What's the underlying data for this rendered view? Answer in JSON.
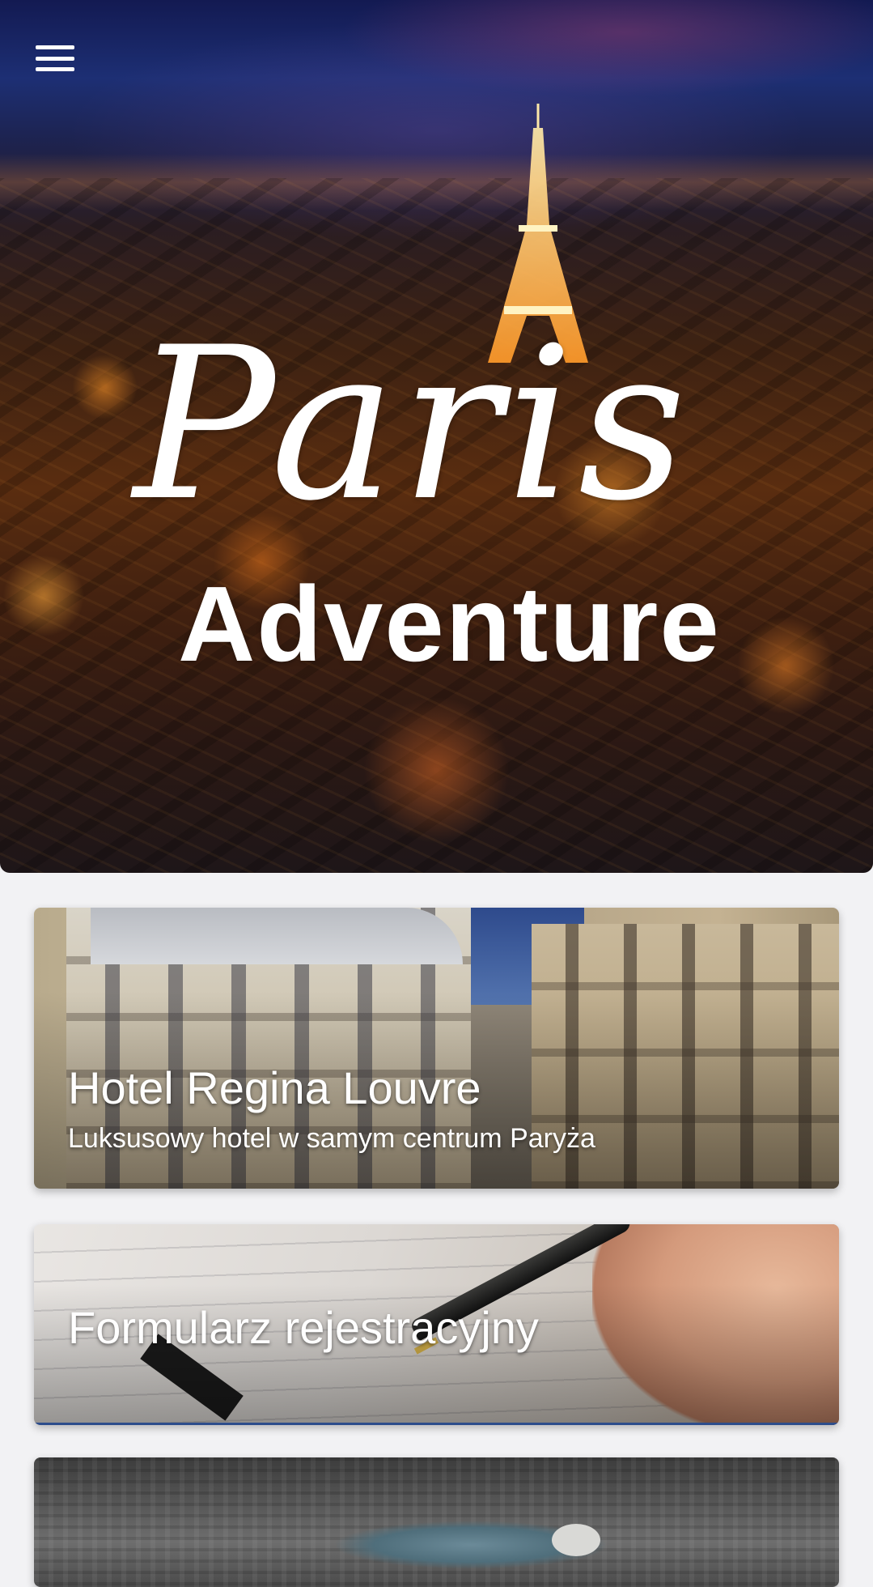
{
  "app": {
    "logo_line1": "Paris",
    "logo_line2": "Adventure"
  },
  "header": {
    "menu_icon": "hamburger-menu-icon"
  },
  "cards": [
    {
      "title": "Hotel Regina Louvre",
      "subtitle": "Luksusowy hotel w samym centrum Paryża"
    },
    {
      "title": "Formularz rejestracyjny",
      "subtitle": ""
    },
    {
      "title": "",
      "subtitle": ""
    }
  ],
  "colors": {
    "background": "#f2f2f4",
    "card_text": "#ffffff",
    "hero_sky": "#1d2f74",
    "city_glow": "#ff9a3c"
  }
}
